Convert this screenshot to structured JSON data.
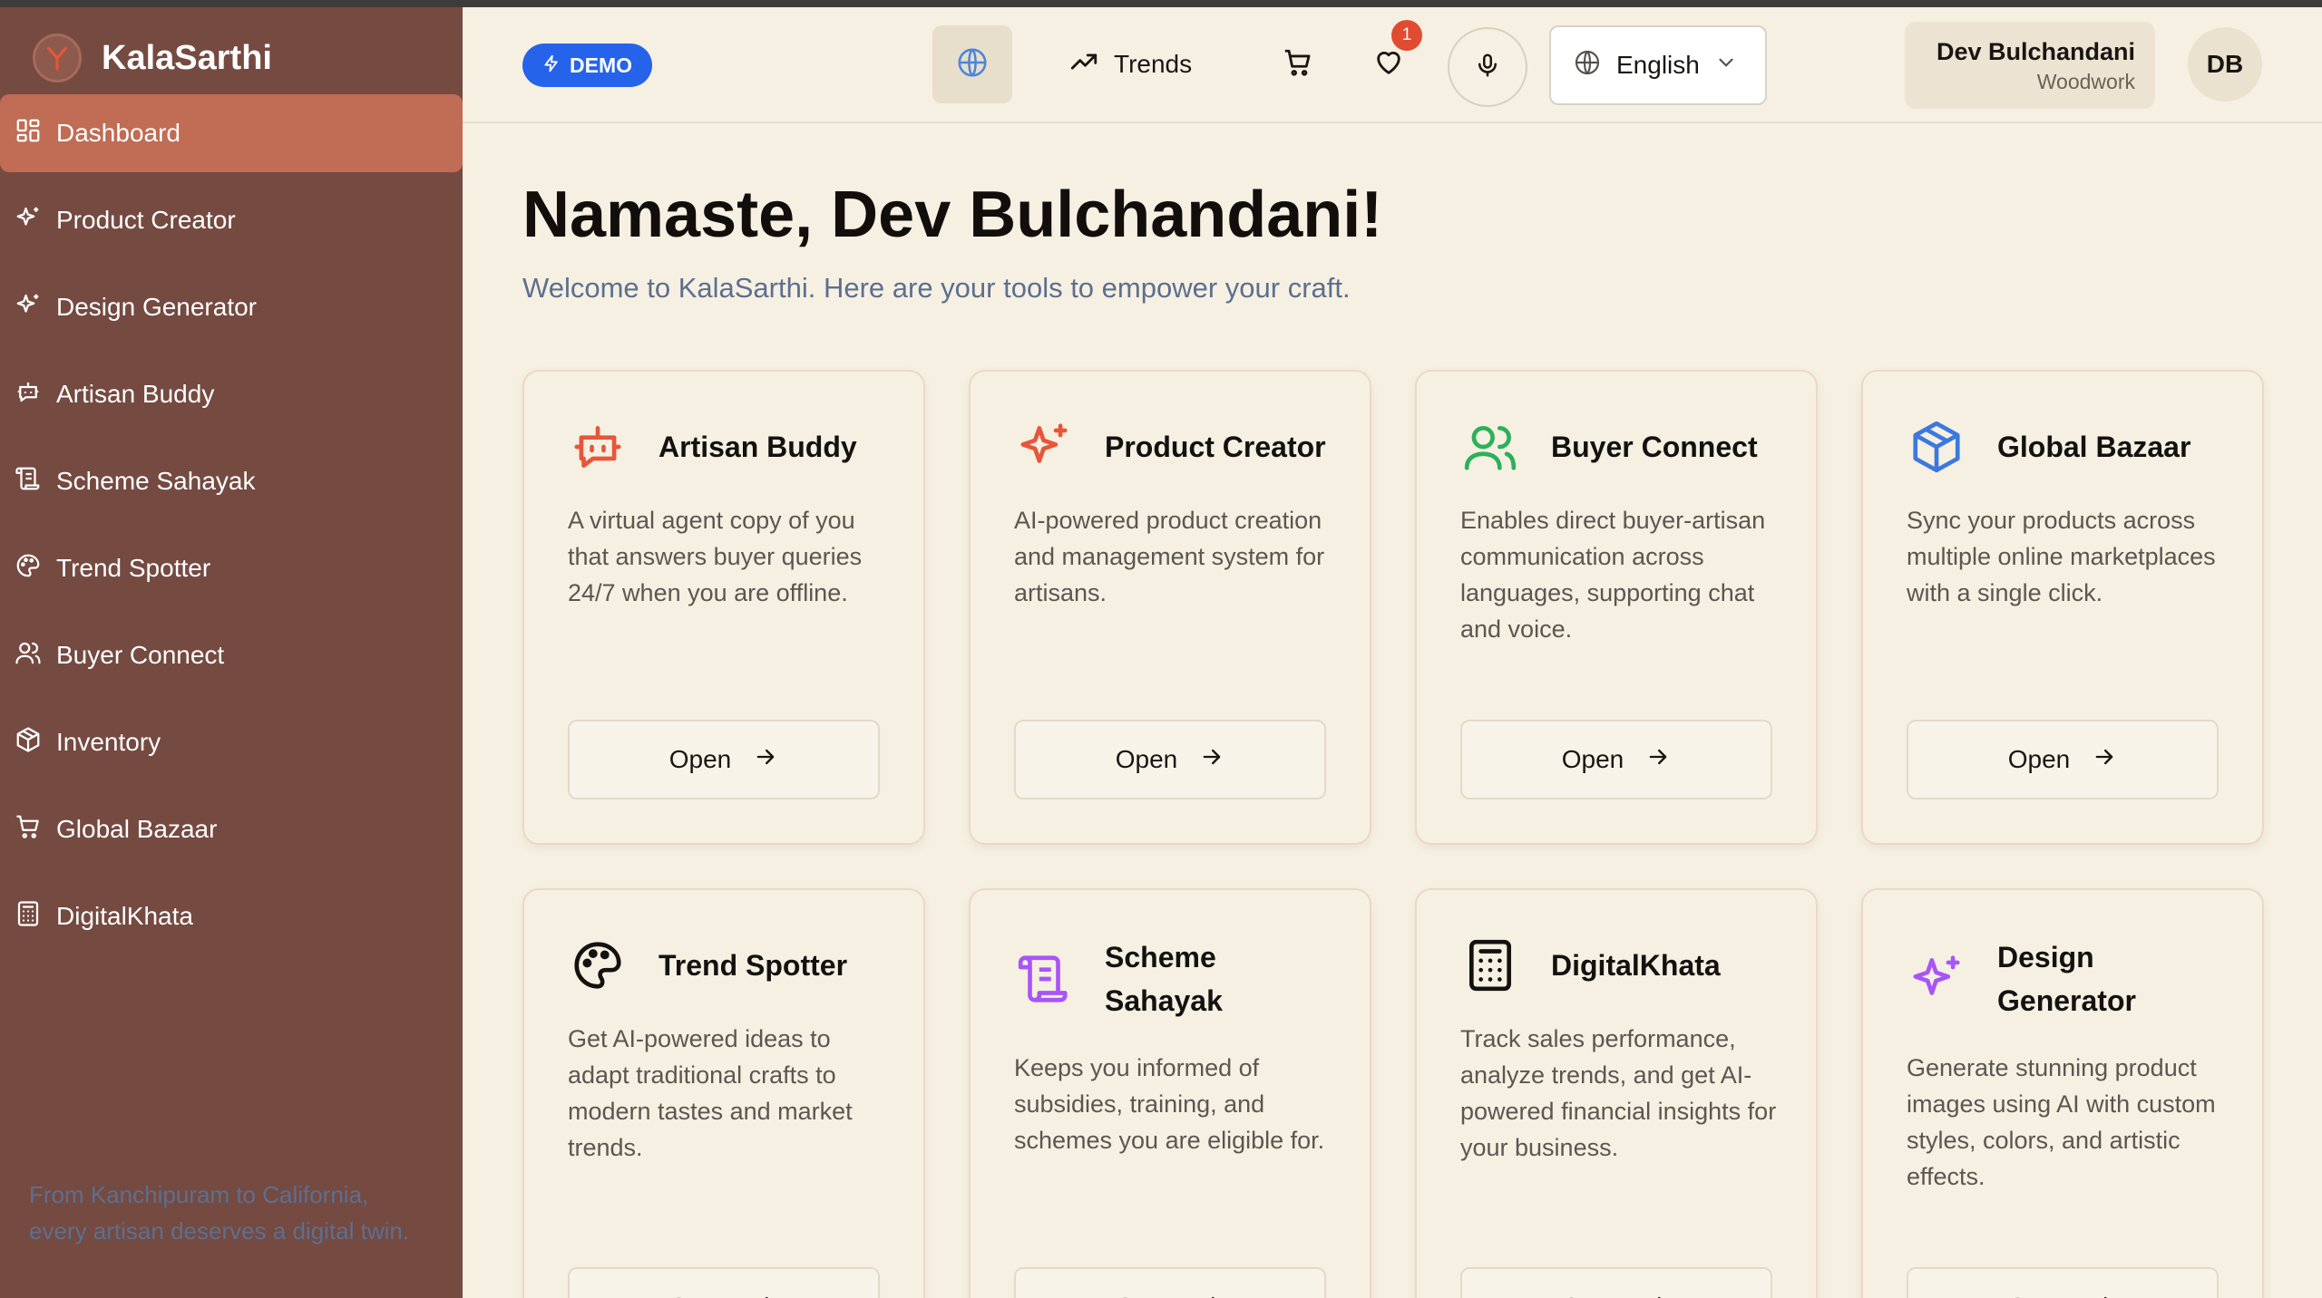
{
  "brand": {
    "name": "KalaSarthi"
  },
  "sidebar": {
    "items": [
      {
        "label": "Dashboard",
        "icon": "dashboard-icon",
        "active": true
      },
      {
        "label": "Product Creator",
        "icon": "sparkles-icon"
      },
      {
        "label": "Design Generator",
        "icon": "sparkles-icon"
      },
      {
        "label": "Artisan Buddy",
        "icon": "bot-message-icon"
      },
      {
        "label": "Scheme Sahayak",
        "icon": "scroll-icon"
      },
      {
        "label": "Trend Spotter",
        "icon": "palette-icon"
      },
      {
        "label": "Buyer Connect",
        "icon": "users-icon"
      },
      {
        "label": "Inventory",
        "icon": "package-icon"
      },
      {
        "label": "Global Bazaar",
        "icon": "cart-icon"
      },
      {
        "label": "DigitalKhata",
        "icon": "calculator-icon"
      }
    ],
    "tagline": "From Kanchipuram to California, every artisan deserves a digital twin."
  },
  "header": {
    "demo_label": "DEMO",
    "trends_label": "Trends",
    "wishlist_count": "1",
    "language": "English",
    "user_name": "Dev Bulchandani",
    "user_role": "Woodwork",
    "avatar_initials": "DB"
  },
  "main": {
    "greeting": "Namaste, Dev Bulchandani!",
    "subtitle": "Welcome to KalaSarthi. Here are your tools to empower your craft.",
    "open_label": "Open",
    "cards": [
      {
        "title": "Artisan Buddy",
        "desc": "A virtual agent copy of you that answers buyer queries 24/7 when you are offline.",
        "icon": "bot-message-icon",
        "color": "#e8553a"
      },
      {
        "title": "Product Creator",
        "desc": "AI-powered product creation and management system for artisans.",
        "icon": "sparkles-icon",
        "color": "#e8553a"
      },
      {
        "title": "Buyer Connect",
        "desc": "Enables direct buyer-artisan communication across languages, supporting chat and voice.",
        "icon": "users-icon",
        "color": "#2bb15a"
      },
      {
        "title": "Global Bazaar",
        "desc": "Sync your products across multiple online marketplaces with a single click.",
        "icon": "package-icon",
        "color": "#3b78e0"
      },
      {
        "title": "Trend Spotter",
        "desc": "Get AI-powered ideas to adapt traditional crafts to modern tastes and market trends.",
        "icon": "palette-icon",
        "color": "#141110"
      },
      {
        "title": "Scheme Sahayak",
        "desc": "Keeps you informed of subsidies, training, and schemes you are eligible for.",
        "icon": "scroll-icon",
        "color": "#a855f7"
      },
      {
        "title": "DigitalKhata",
        "desc": "Track sales performance, analyze trends, and get AI-powered financial insights for your business.",
        "icon": "calculator-icon",
        "color": "#141110"
      },
      {
        "title": "Design Generator",
        "desc": "Generate stunning product images using AI with custom styles, colors, and artistic effects.",
        "icon": "sparkles-icon",
        "color": "#a855f7"
      }
    ]
  }
}
